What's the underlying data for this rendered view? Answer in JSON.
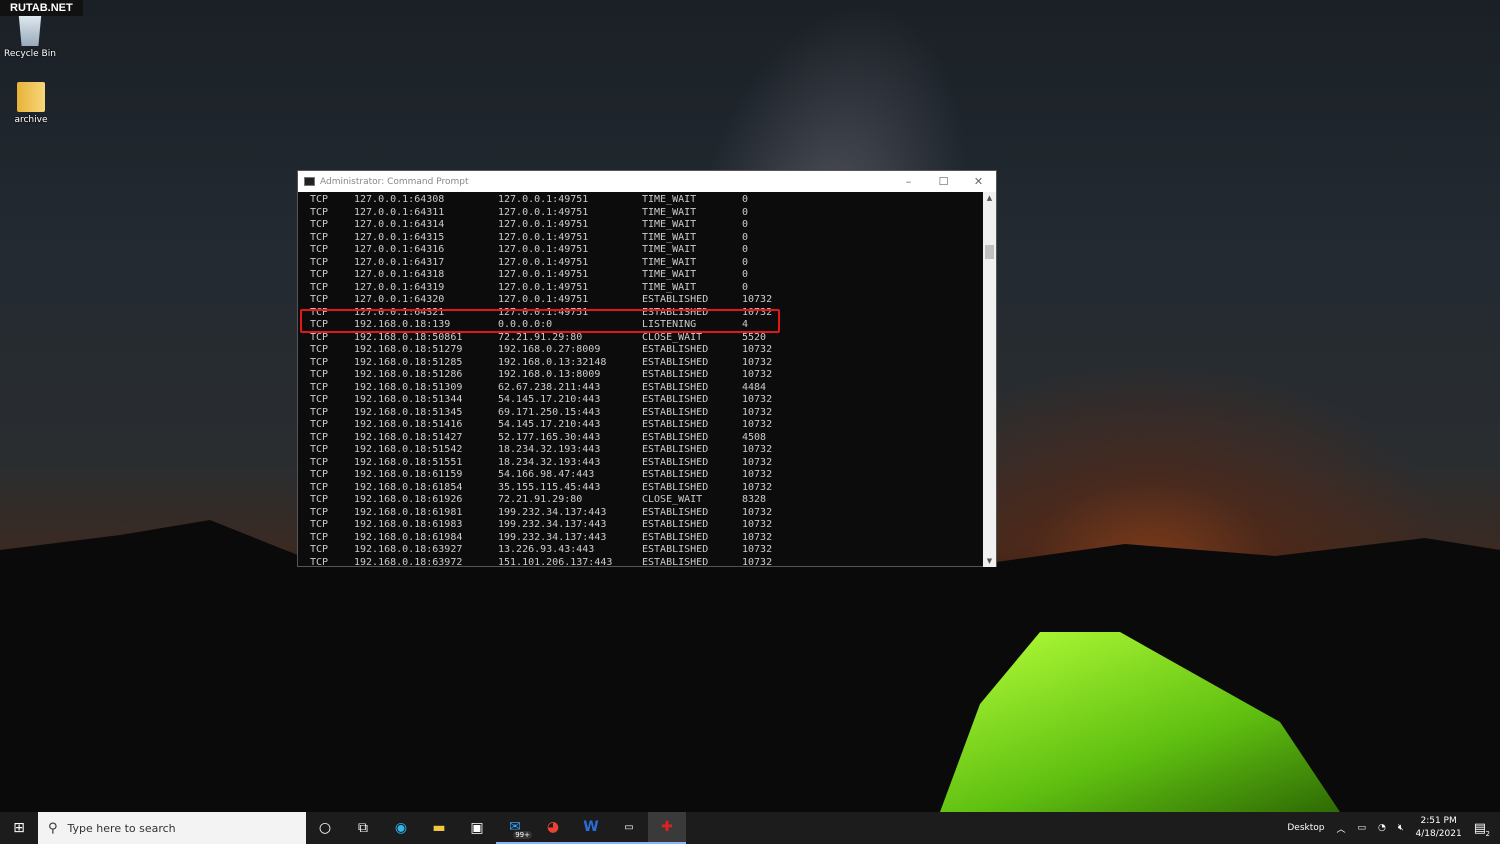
{
  "watermark": "RUTAB.NET",
  "desktop": [
    {
      "label": "Recycle Bin",
      "icon": "recycle-bin-icon"
    },
    {
      "label": "archive",
      "icon": "archive-folder-icon"
    }
  ],
  "window": {
    "title": "Administrator: Command Prompt",
    "controls": [
      "–",
      "☐",
      "✕"
    ]
  },
  "rows": [
    [
      "TCP",
      "127.0.0.1:64308",
      "127.0.0.1:49751",
      "TIME_WAIT",
      "0"
    ],
    [
      "TCP",
      "127.0.0.1:64311",
      "127.0.0.1:49751",
      "TIME_WAIT",
      "0"
    ],
    [
      "TCP",
      "127.0.0.1:64314",
      "127.0.0.1:49751",
      "TIME_WAIT",
      "0"
    ],
    [
      "TCP",
      "127.0.0.1:64315",
      "127.0.0.1:49751",
      "TIME_WAIT",
      "0"
    ],
    [
      "TCP",
      "127.0.0.1:64316",
      "127.0.0.1:49751",
      "TIME_WAIT",
      "0"
    ],
    [
      "TCP",
      "127.0.0.1:64317",
      "127.0.0.1:49751",
      "TIME_WAIT",
      "0"
    ],
    [
      "TCP",
      "127.0.0.1:64318",
      "127.0.0.1:49751",
      "TIME_WAIT",
      "0"
    ],
    [
      "TCP",
      "127.0.0.1:64319",
      "127.0.0.1:49751",
      "TIME_WAIT",
      "0"
    ],
    [
      "TCP",
      "127.0.0.1:64320",
      "127.0.0.1:49751",
      "ESTABLISHED",
      "10732"
    ],
    [
      "TCP",
      "127.0.0.1:64321",
      "127.0.0.1:49751",
      "ESTABLISHED",
      "10732"
    ],
    [
      "TCP",
      "192.168.0.18:139",
      "0.0.0.0:0",
      "LISTENING",
      "4"
    ],
    [
      "TCP",
      "192.168.0.18:50861",
      "72.21.91.29:80",
      "CLOSE_WAIT",
      "5520"
    ],
    [
      "TCP",
      "192.168.0.18:51279",
      "192.168.0.27:8009",
      "ESTABLISHED",
      "10732"
    ],
    [
      "TCP",
      "192.168.0.18:51285",
      "192.168.0.13:32148",
      "ESTABLISHED",
      "10732"
    ],
    [
      "TCP",
      "192.168.0.18:51286",
      "192.168.0.13:8009",
      "ESTABLISHED",
      "10732"
    ],
    [
      "TCP",
      "192.168.0.18:51309",
      "62.67.238.211:443",
      "ESTABLISHED",
      "4484"
    ],
    [
      "TCP",
      "192.168.0.18:51344",
      "54.145.17.210:443",
      "ESTABLISHED",
      "10732"
    ],
    [
      "TCP",
      "192.168.0.18:51345",
      "69.171.250.15:443",
      "ESTABLISHED",
      "10732"
    ],
    [
      "TCP",
      "192.168.0.18:51416",
      "54.145.17.210:443",
      "ESTABLISHED",
      "10732"
    ],
    [
      "TCP",
      "192.168.0.18:51427",
      "52.177.165.30:443",
      "ESTABLISHED",
      "4508"
    ],
    [
      "TCP",
      "192.168.0.18:51542",
      "18.234.32.193:443",
      "ESTABLISHED",
      "10732"
    ],
    [
      "TCP",
      "192.168.0.18:51551",
      "18.234.32.193:443",
      "ESTABLISHED",
      "10732"
    ],
    [
      "TCP",
      "192.168.0.18:61159",
      "54.166.98.47:443",
      "ESTABLISHED",
      "10732"
    ],
    [
      "TCP",
      "192.168.0.18:61854",
      "35.155.115.45:443",
      "ESTABLISHED",
      "10732"
    ],
    [
      "TCP",
      "192.168.0.18:61926",
      "72.21.91.29:80",
      "CLOSE_WAIT",
      "8328"
    ],
    [
      "TCP",
      "192.168.0.18:61981",
      "199.232.34.137:443",
      "ESTABLISHED",
      "10732"
    ],
    [
      "TCP",
      "192.168.0.18:61983",
      "199.232.34.137:443",
      "ESTABLISHED",
      "10732"
    ],
    [
      "TCP",
      "192.168.0.18:61984",
      "199.232.34.137:443",
      "ESTABLISHED",
      "10732"
    ],
    [
      "TCP",
      "192.168.0.18:63927",
      "13.226.93.43:443",
      "ESTABLISHED",
      "10732"
    ],
    [
      "TCP",
      "192.168.0.18:63972",
      "151.101.206.137:443",
      "ESTABLISHED",
      "10732"
    ]
  ],
  "highlight_color": "#e01818",
  "taskbar": {
    "search_placeholder": "Type here to search",
    "mail_badge": "99+",
    "desktop_label": "Desktop",
    "time": "2:51 PM",
    "date": "4/18/2021",
    "notif_count": "2"
  }
}
